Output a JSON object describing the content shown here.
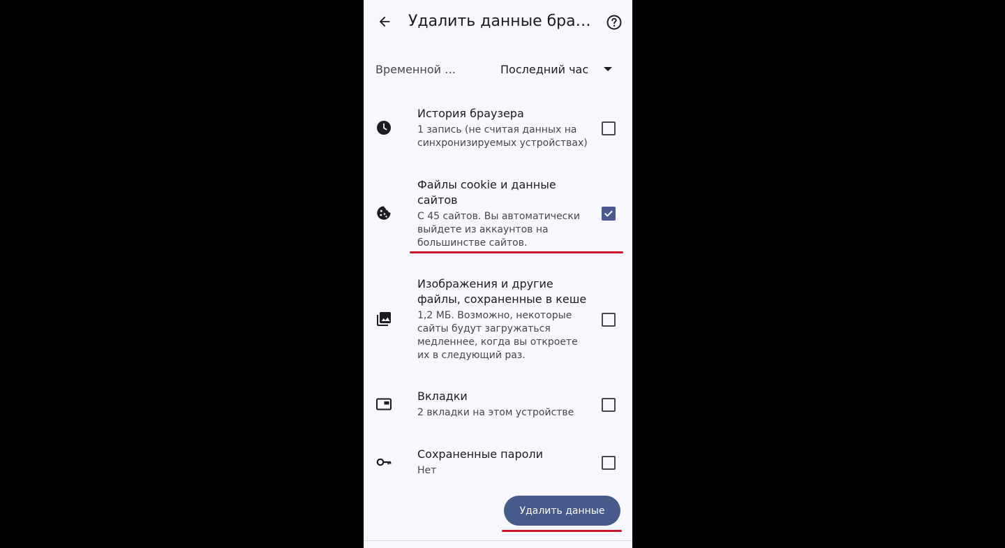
{
  "header": {
    "title": "Удалить данные браузера"
  },
  "time_range": {
    "label": "Временной диапазон",
    "value": "Последний час"
  },
  "items": [
    {
      "title": "История браузера",
      "subtitle": "1 запись (не считая данных на синхронизируемых устройствах)",
      "checked": false,
      "icon": "clock-icon"
    },
    {
      "title": "Файлы cookie и данные сайтов",
      "subtitle": "С 45 сайтов. Вы автоматически выйдете из аккаунтов на большинстве сайтов.",
      "checked": true,
      "icon": "cookie-icon"
    },
    {
      "title": "Изображения и другие файлы, сохраненные в кеше",
      "subtitle": "1,2 МБ. Возможно, некоторые сайты будут загружаться медленнее, когда вы откроете их в следующий раз.",
      "checked": false,
      "icon": "image-icon"
    },
    {
      "title": "Вкладки",
      "subtitle": "2 вкладки на этом устройстве",
      "checked": false,
      "icon": "tabs-icon"
    },
    {
      "title": "Сохраненные пароли",
      "subtitle": "Нет",
      "checked": false,
      "icon": "key-icon"
    }
  ],
  "actions": {
    "delete_label": "Удалить данные"
  },
  "colors": {
    "accent": "#465a8c",
    "annotation_underline": "#c9162b",
    "background": "#f8f7fd"
  }
}
